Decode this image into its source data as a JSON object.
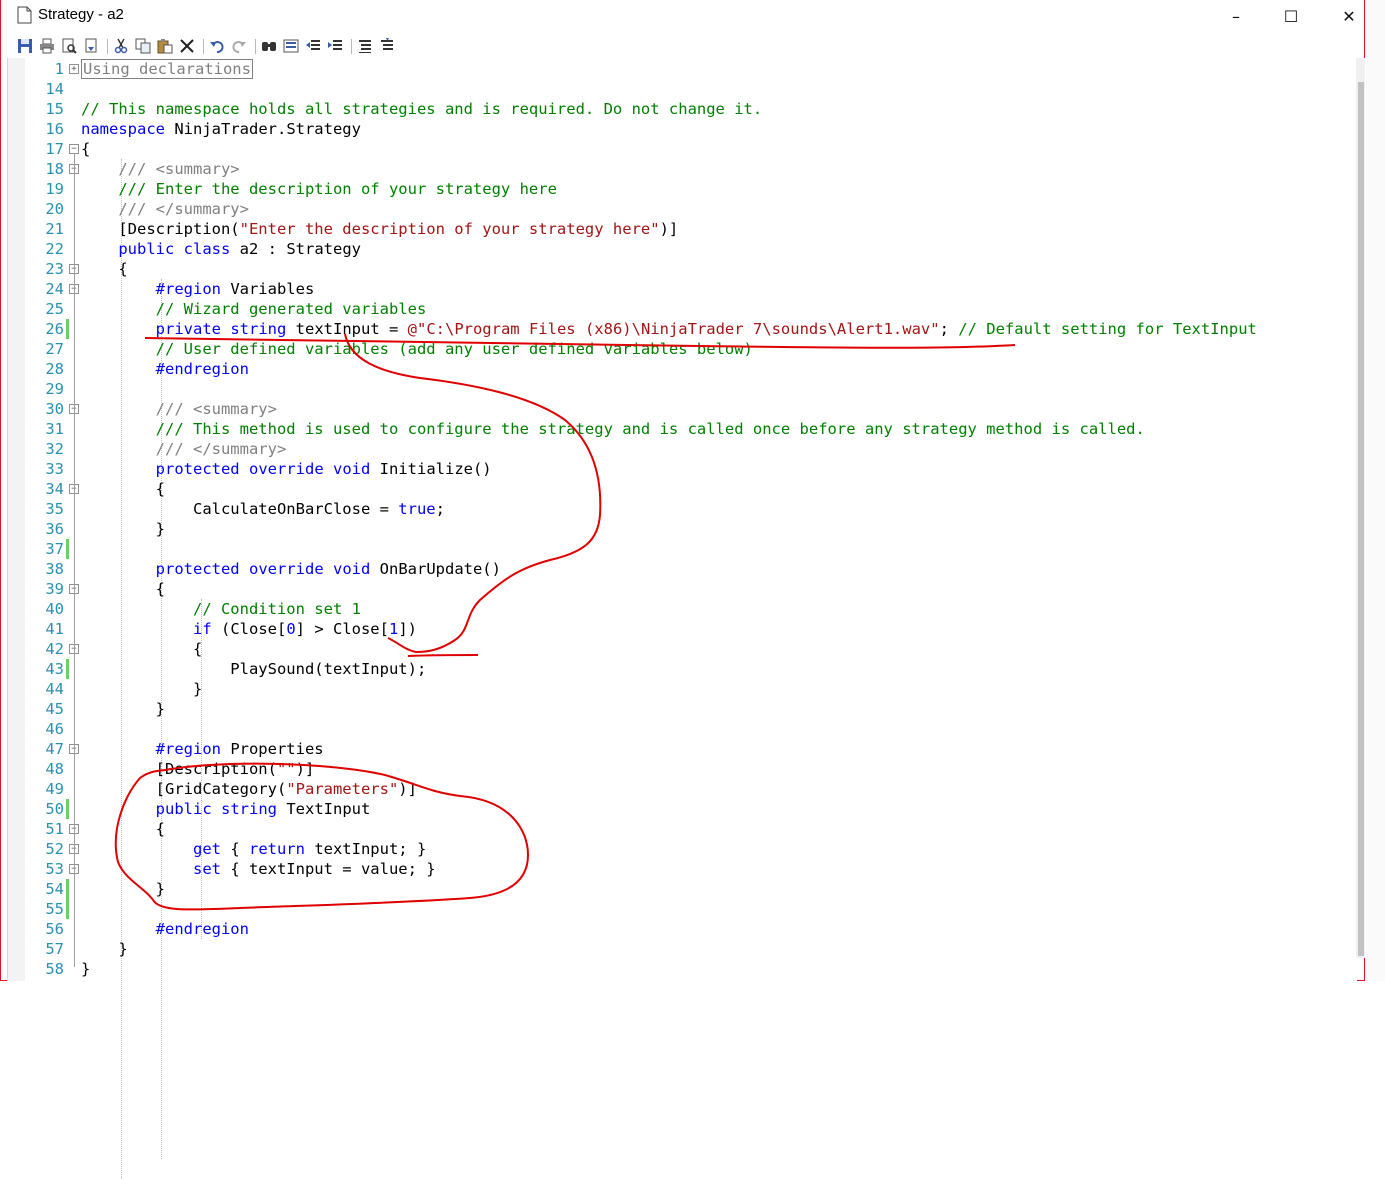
{
  "window": {
    "title": "Strategy - a2",
    "minimize_glyph": "–",
    "maximize_glyph": "☐",
    "close_glyph": "✕"
  },
  "toolbar": {
    "icons": [
      "save-icon",
      "print-icon",
      "print-preview-icon",
      "page-setup-icon",
      "cut-icon",
      "copy-icon",
      "paste-icon",
      "delete-icon",
      "undo-icon",
      "redo-icon",
      "find-icon",
      "replace-icon",
      "outdent-icon",
      "indent-icon",
      "comment-icon",
      "uncomment-icon"
    ]
  },
  "editor": {
    "lines": [
      {
        "num": "1",
        "fold": "plus",
        "segments": [
          {
            "t": "Using declarations",
            "c": "box"
          }
        ]
      },
      {
        "num": "14",
        "segments": []
      },
      {
        "num": "15",
        "segments": [
          {
            "t": "// This namespace holds all strategies and is required. Do not change it.",
            "c": "cm"
          }
        ]
      },
      {
        "num": "16",
        "segments": [
          {
            "t": "namespace",
            "c": "kw"
          },
          {
            "t": " NinjaTrader.Strategy",
            "c": ""
          }
        ]
      },
      {
        "num": "17",
        "fold": "minus",
        "segments": [
          {
            "t": "{",
            "c": ""
          }
        ]
      },
      {
        "num": "18",
        "fold": "minus",
        "segments": [
          {
            "t": "    /// ",
            "c": "gr"
          },
          {
            "t": "<summary>",
            "c": "gr"
          }
        ]
      },
      {
        "num": "19",
        "segments": [
          {
            "t": "    /// Enter the description of your strategy here",
            "c": "cm"
          }
        ]
      },
      {
        "num": "20",
        "segments": [
          {
            "t": "    /// </summary>",
            "c": "gr"
          }
        ]
      },
      {
        "num": "21",
        "segments": [
          {
            "t": "    [Description(",
            "c": ""
          },
          {
            "t": "\"Enter the description of your strategy here\"",
            "c": "st"
          },
          {
            "t": ")]",
            "c": ""
          }
        ]
      },
      {
        "num": "22",
        "segments": [
          {
            "t": "    ",
            "c": ""
          },
          {
            "t": "public",
            "c": "kw"
          },
          {
            "t": " ",
            "c": ""
          },
          {
            "t": "class",
            "c": "kw"
          },
          {
            "t": " a2 : Strategy",
            "c": ""
          }
        ]
      },
      {
        "num": "23",
        "fold": "minus",
        "segments": [
          {
            "t": "    {",
            "c": ""
          }
        ]
      },
      {
        "num": "24",
        "fold": "minus",
        "segments": [
          {
            "t": "        ",
            "c": ""
          },
          {
            "t": "#region",
            "c": "kw"
          },
          {
            "t": " Variables",
            "c": ""
          }
        ]
      },
      {
        "num": "25",
        "segments": [
          {
            "t": "        // Wizard generated variables",
            "c": "cm"
          }
        ]
      },
      {
        "num": "26",
        "mod": true,
        "segments": [
          {
            "t": "        ",
            "c": ""
          },
          {
            "t": "private",
            "c": "kw"
          },
          {
            "t": " ",
            "c": ""
          },
          {
            "t": "string",
            "c": "kw"
          },
          {
            "t": " textInput = ",
            "c": ""
          },
          {
            "t": "@\"C:\\Program Files (x86)\\NinjaTrader 7\\sounds\\Alert1.wav\"",
            "c": "st"
          },
          {
            "t": "; ",
            "c": ""
          },
          {
            "t": "// Default setting for TextInput",
            "c": "cm"
          }
        ]
      },
      {
        "num": "27",
        "segments": [
          {
            "t": "        // User defined variables (add any user defined variables below)",
            "c": "cm"
          }
        ]
      },
      {
        "num": "28",
        "segments": [
          {
            "t": "        ",
            "c": ""
          },
          {
            "t": "#endregion",
            "c": "kw"
          }
        ]
      },
      {
        "num": "29",
        "segments": []
      },
      {
        "num": "30",
        "fold": "minus",
        "segments": [
          {
            "t": "        /// ",
            "c": "gr"
          },
          {
            "t": "<summary>",
            "c": "gr"
          }
        ]
      },
      {
        "num": "31",
        "segments": [
          {
            "t": "        /// This method is used to configure the strategy and is called once before any strategy method is called.",
            "c": "cm"
          }
        ]
      },
      {
        "num": "32",
        "segments": [
          {
            "t": "        /// </summary>",
            "c": "gr"
          }
        ]
      },
      {
        "num": "33",
        "segments": [
          {
            "t": "        ",
            "c": ""
          },
          {
            "t": "protected",
            "c": "kw"
          },
          {
            "t": " ",
            "c": ""
          },
          {
            "t": "override",
            "c": "kw"
          },
          {
            "t": " ",
            "c": ""
          },
          {
            "t": "void",
            "c": "kw"
          },
          {
            "t": " Initialize()",
            "c": ""
          }
        ]
      },
      {
        "num": "34",
        "fold": "minus",
        "segments": [
          {
            "t": "        {",
            "c": ""
          }
        ]
      },
      {
        "num": "35",
        "segments": [
          {
            "t": "            CalculateOnBarClose = ",
            "c": ""
          },
          {
            "t": "true",
            "c": "kw"
          },
          {
            "t": ";",
            "c": ""
          }
        ]
      },
      {
        "num": "36",
        "segments": [
          {
            "t": "        }",
            "c": ""
          }
        ]
      },
      {
        "num": "37",
        "mod": true,
        "segments": []
      },
      {
        "num": "38",
        "segments": [
          {
            "t": "        ",
            "c": ""
          },
          {
            "t": "protected",
            "c": "kw"
          },
          {
            "t": " ",
            "c": ""
          },
          {
            "t": "override",
            "c": "kw"
          },
          {
            "t": " ",
            "c": ""
          },
          {
            "t": "void",
            "c": "kw"
          },
          {
            "t": " OnBarUpdate()",
            "c": ""
          }
        ]
      },
      {
        "num": "39",
        "fold": "minus",
        "segments": [
          {
            "t": "        {",
            "c": ""
          }
        ]
      },
      {
        "num": "40",
        "segments": [
          {
            "t": "            // Condition set 1",
            "c": "cm"
          }
        ]
      },
      {
        "num": "41",
        "segments": [
          {
            "t": "            ",
            "c": ""
          },
          {
            "t": "if",
            "c": "kw"
          },
          {
            "t": " (Close[",
            "c": ""
          },
          {
            "t": "0",
            "c": "kw"
          },
          {
            "t": "] > Close[",
            "c": ""
          },
          {
            "t": "1",
            "c": "kw"
          },
          {
            "t": "])",
            "c": ""
          }
        ]
      },
      {
        "num": "42",
        "fold": "minus",
        "segments": [
          {
            "t": "            {",
            "c": ""
          }
        ]
      },
      {
        "num": "43",
        "mod": true,
        "segments": [
          {
            "t": "                PlaySound(textInput);",
            "c": ""
          }
        ]
      },
      {
        "num": "44",
        "segments": [
          {
            "t": "            }",
            "c": ""
          }
        ]
      },
      {
        "num": "45",
        "segments": [
          {
            "t": "        }",
            "c": ""
          }
        ]
      },
      {
        "num": "46",
        "segments": []
      },
      {
        "num": "47",
        "fold": "minus",
        "segments": [
          {
            "t": "        ",
            "c": ""
          },
          {
            "t": "#region",
            "c": "kw"
          },
          {
            "t": " Properties",
            "c": ""
          }
        ]
      },
      {
        "num": "48",
        "segments": [
          {
            "t": "        [Description(",
            "c": ""
          },
          {
            "t": "\"\"",
            "c": "st"
          },
          {
            "t": ")]",
            "c": ""
          }
        ]
      },
      {
        "num": "49",
        "segments": [
          {
            "t": "        [GridCategory(",
            "c": ""
          },
          {
            "t": "\"Parameters\"",
            "c": "st"
          },
          {
            "t": ")]",
            "c": ""
          }
        ]
      },
      {
        "num": "50",
        "mod": true,
        "segments": [
          {
            "t": "        ",
            "c": ""
          },
          {
            "t": "public",
            "c": "kw"
          },
          {
            "t": " ",
            "c": ""
          },
          {
            "t": "string",
            "c": "kw"
          },
          {
            "t": " TextInput",
            "c": ""
          }
        ]
      },
      {
        "num": "51",
        "fold": "minus",
        "segments": [
          {
            "t": "        {",
            "c": ""
          }
        ]
      },
      {
        "num": "52",
        "fold": "minus",
        "segments": [
          {
            "t": "            ",
            "c": ""
          },
          {
            "t": "get",
            "c": "kw"
          },
          {
            "t": " { ",
            "c": ""
          },
          {
            "t": "return",
            "c": "kw"
          },
          {
            "t": " textInput; }",
            "c": ""
          }
        ]
      },
      {
        "num": "53",
        "fold": "minus",
        "segments": [
          {
            "t": "            ",
            "c": ""
          },
          {
            "t": "set",
            "c": "kw"
          },
          {
            "t": " { textInput = value; }",
            "c": ""
          }
        ]
      },
      {
        "num": "54",
        "mod": true,
        "segments": [
          {
            "t": "        }",
            "c": ""
          }
        ]
      },
      {
        "num": "55",
        "mod": true,
        "segments": []
      },
      {
        "num": "56",
        "segments": [
          {
            "t": "        ",
            "c": ""
          },
          {
            "t": "#endregion",
            "c": "kw"
          }
        ]
      },
      {
        "num": "57",
        "segments": [
          {
            "t": "    }",
            "c": ""
          }
        ]
      },
      {
        "num": "58",
        "segments": [
          {
            "t": "}",
            "c": ""
          }
        ]
      }
    ]
  },
  "colors": {
    "keyword": "#0000ff",
    "comment": "#008000",
    "string": "#a31515",
    "line_number": "#2b91af",
    "annotation": "#e00000"
  }
}
